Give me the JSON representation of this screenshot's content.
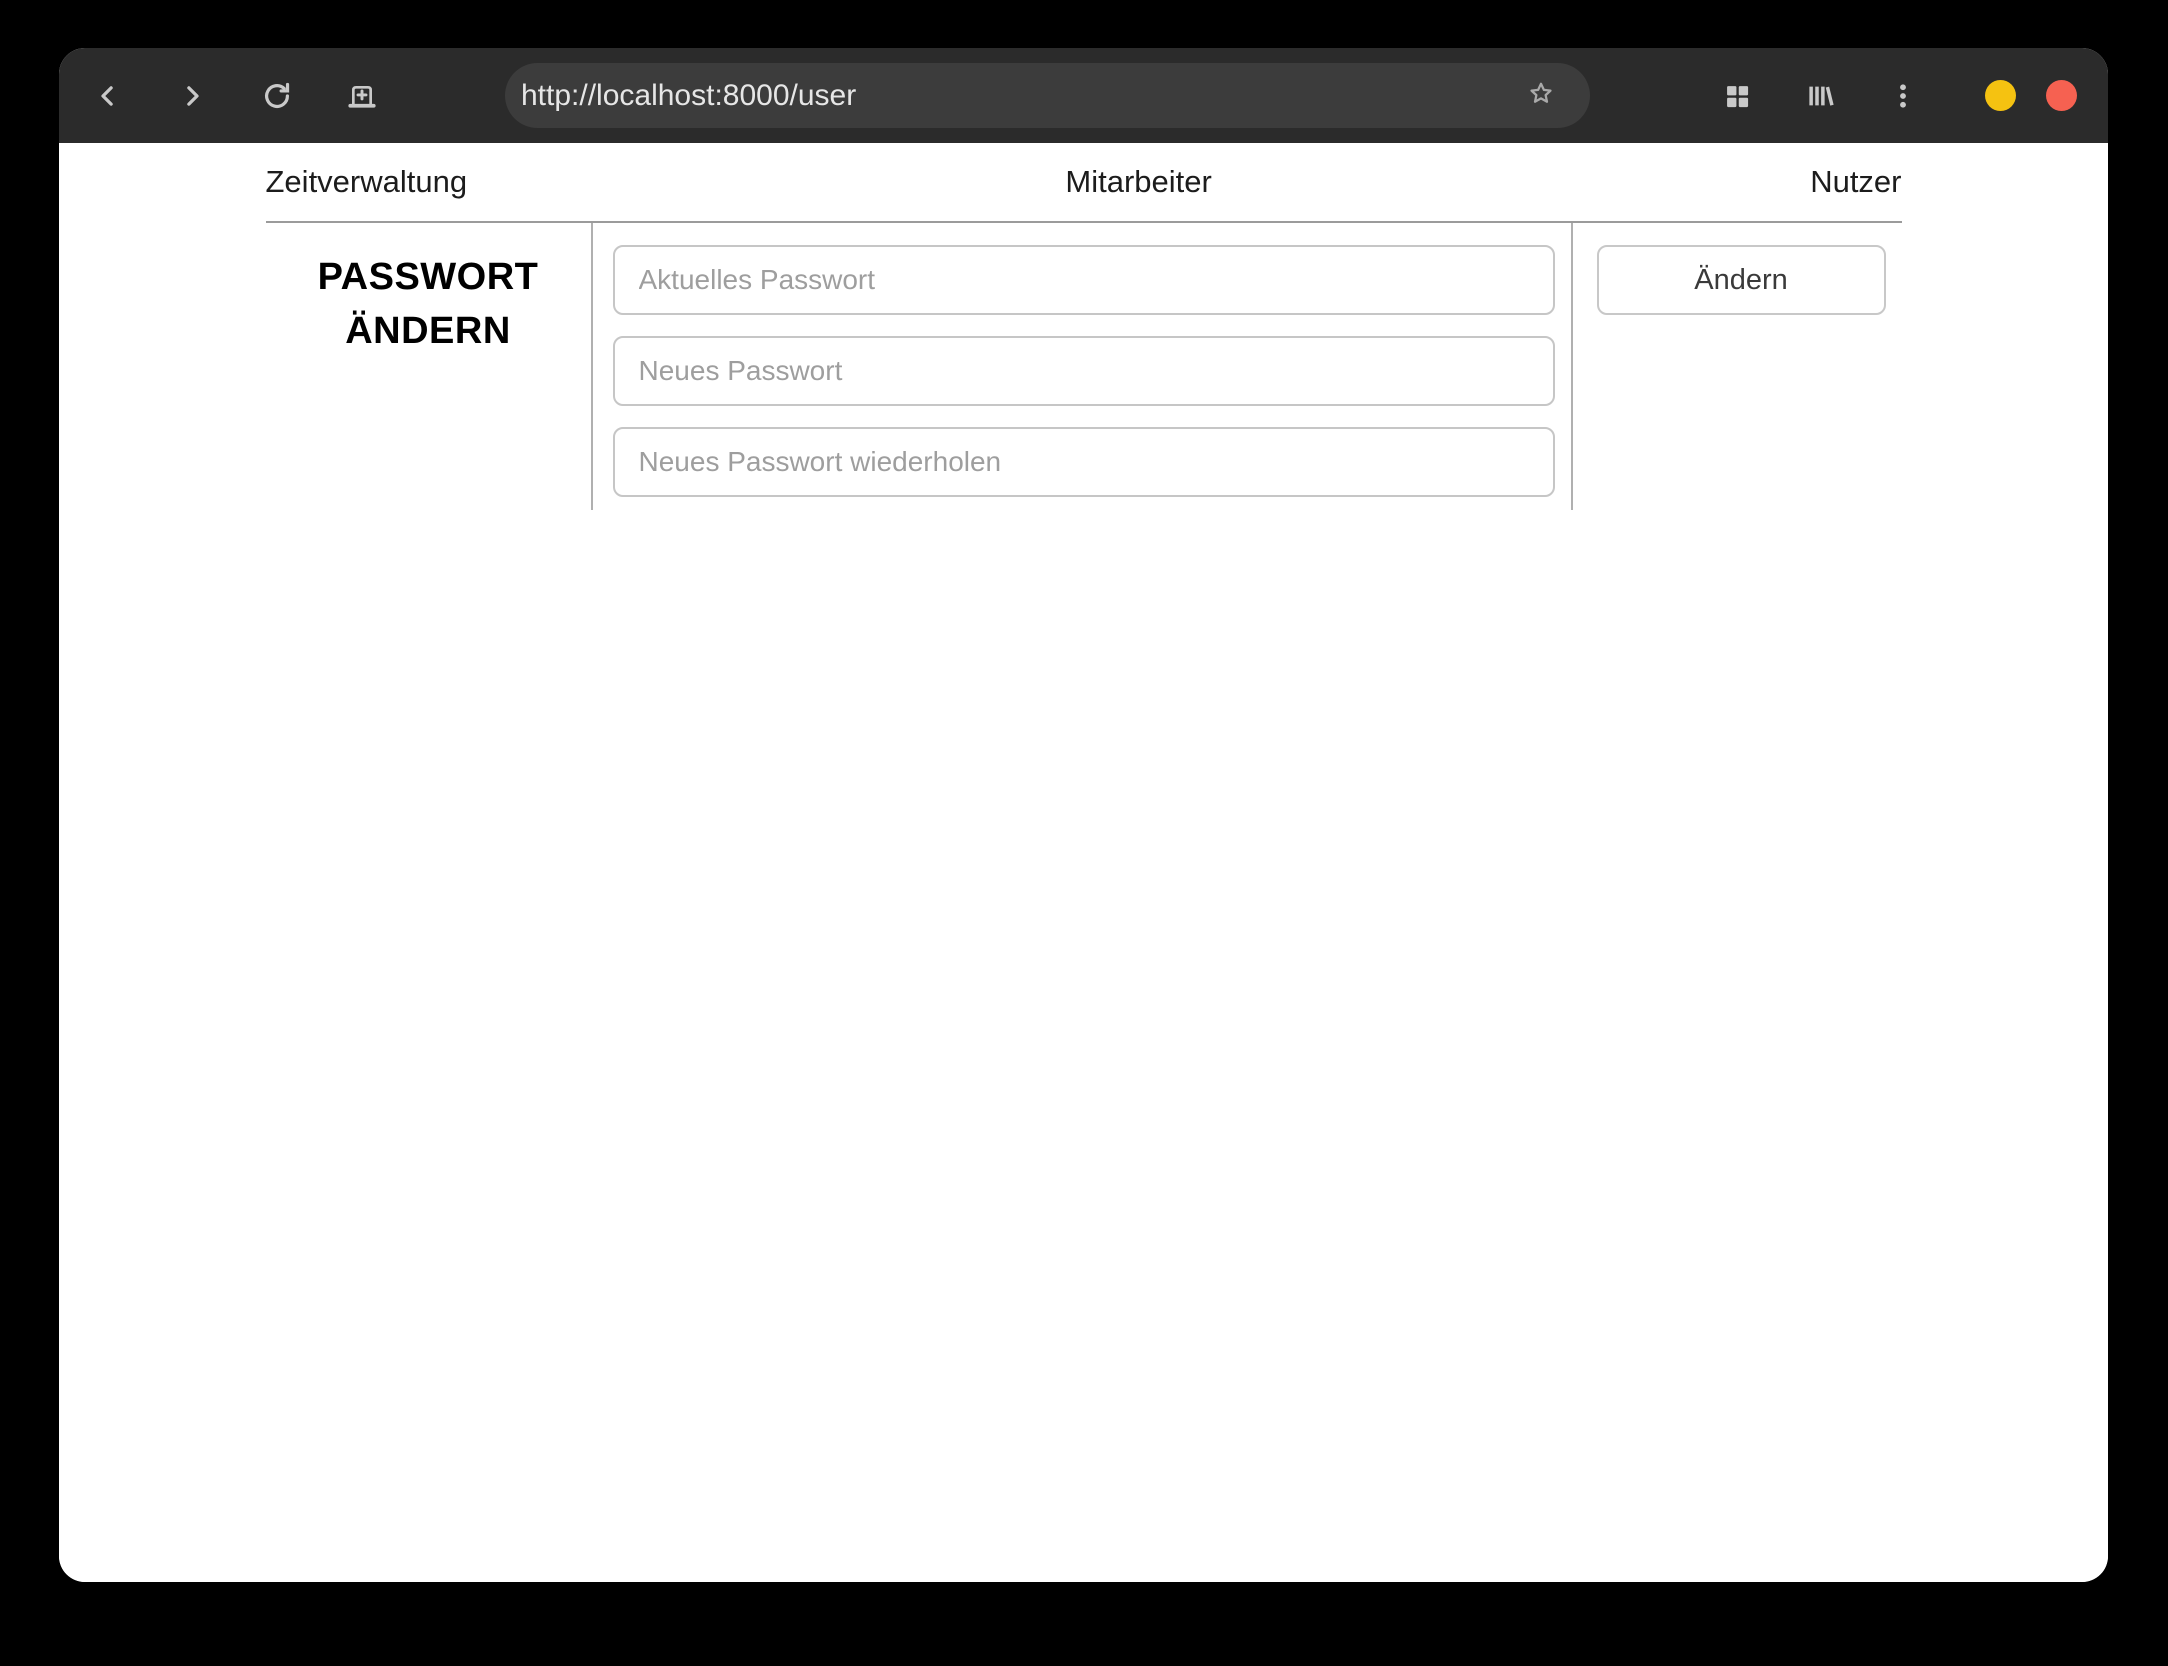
{
  "browser": {
    "toolbar": {
      "url": "http://localhost:8000/user",
      "back_icon": "chevron-left",
      "forward_icon": "chevron-right",
      "reload_icon": "reload-circular-arrow",
      "new_tab_icon": "new-tab-plus",
      "bookmark_icon": "star-outline",
      "apps_icon": "grid-2x2",
      "library_icon": "library-books",
      "menu_icon": "kebab-vertical-dots"
    },
    "window_controls": [
      {
        "name": "minimize",
        "color": "#f5c211"
      },
      {
        "name": "close",
        "color": "#f66151"
      }
    ]
  },
  "nav": {
    "items": [
      {
        "label": "Zeitverwaltung"
      },
      {
        "label": "Mitarbeiter"
      },
      {
        "label": "Nutzer"
      }
    ]
  },
  "password_form": {
    "title_line1": "PASSWORT",
    "title_line2": "ÄNDERN",
    "fields": [
      {
        "placeholder": "Aktuelles Passwort",
        "value": ""
      },
      {
        "placeholder": "Neues Passwort",
        "value": ""
      },
      {
        "placeholder": "Neues Passwort wiederholen",
        "value": ""
      }
    ],
    "submit_label": "Ändern"
  },
  "colors": {
    "outer_background": "#000000",
    "toolbar_background": "#2b2b2b",
    "urlbar_background": "#3c3c3c",
    "page_background": "#ffffff",
    "minimize_control": "#f5c211",
    "close_control": "#f66151",
    "nav_divider": "#9b9b9b",
    "column_divider": "#b0b0b0",
    "input_border": "#c6c6c6",
    "placeholder_text": "#9e9e9e",
    "icon_gray": "#c9c9c9"
  }
}
